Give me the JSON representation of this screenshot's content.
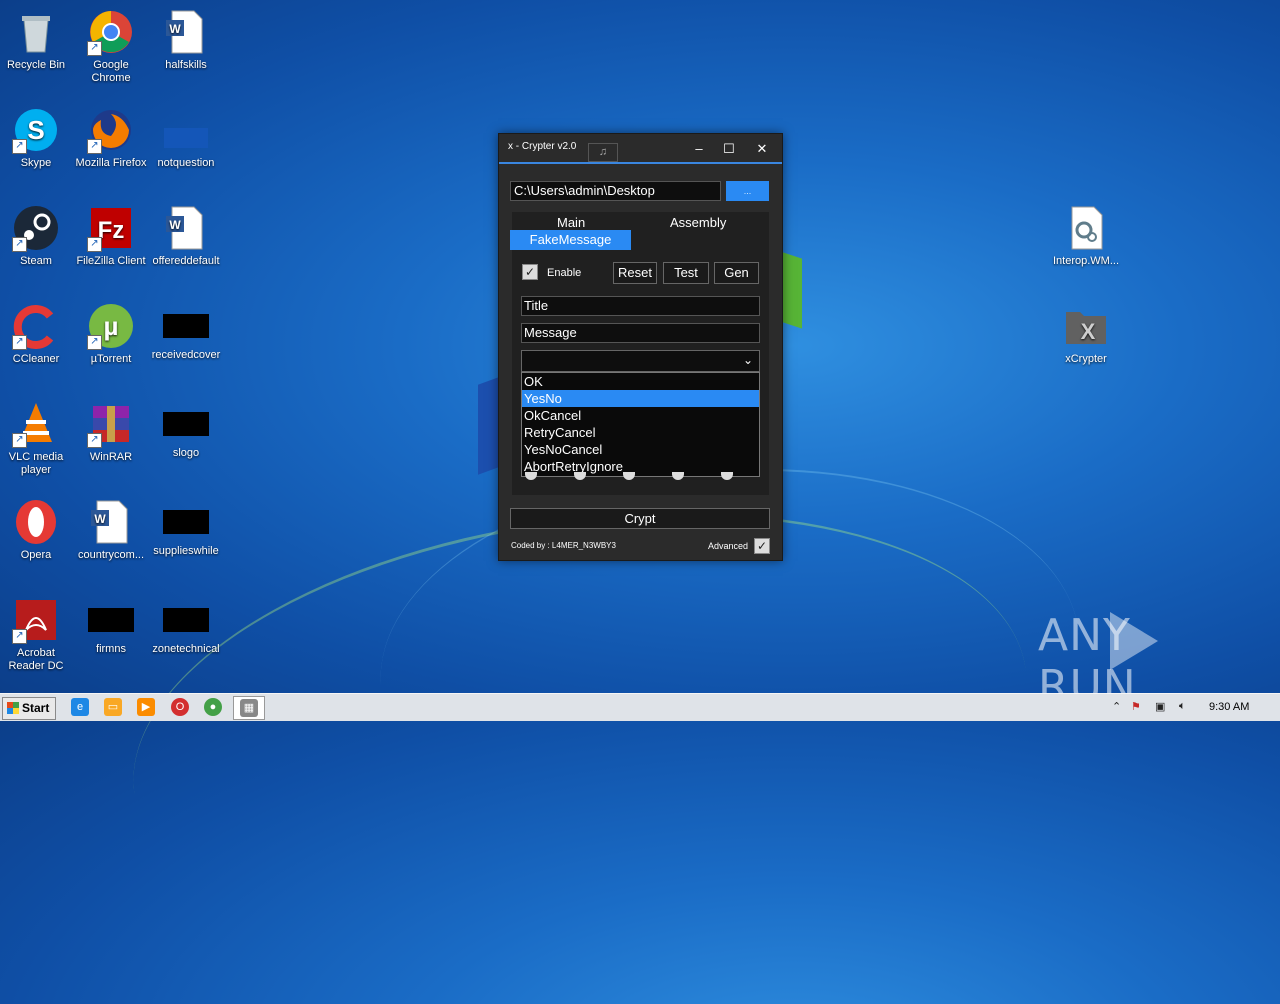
{
  "desktop": {
    "icons": [
      {
        "label": "Recycle Bin"
      },
      {
        "label": "Google Chrome"
      },
      {
        "label": "halfskills"
      },
      {
        "label": "Skype"
      },
      {
        "label": "Mozilla Firefox"
      },
      {
        "label": "notquestion"
      },
      {
        "label": "Steam"
      },
      {
        "label": "FileZilla Client"
      },
      {
        "label": "offereddefault"
      },
      {
        "label": "CCleaner"
      },
      {
        "label": "µTorrent"
      },
      {
        "label": "receivedcover"
      },
      {
        "label": "VLC media player"
      },
      {
        "label": "WinRAR"
      },
      {
        "label": "slogo"
      },
      {
        "label": "Opera"
      },
      {
        "label": "countrycom..."
      },
      {
        "label": "supplieswhile"
      },
      {
        "label": "Acrobat Reader DC"
      },
      {
        "label": "firmns"
      },
      {
        "label": "zonetechnical"
      },
      {
        "label": "Interop.WM..."
      },
      {
        "label": "xCrypter"
      }
    ]
  },
  "window": {
    "title": "x - Crypter v2.0",
    "music_icon": "♫",
    "minimize": "–",
    "maximize": "☐",
    "close": "✕",
    "path_value": "C:\\Users\\admin\\Desktop",
    "browse_label": "...",
    "tabs": {
      "main": "Main",
      "assembly": "Assembly",
      "fake_message": "FakeMessage"
    },
    "enable_label": "Enable",
    "enable_checked": true,
    "buttons": {
      "reset": "Reset",
      "test": "Test",
      "gen": "Gen"
    },
    "title_field": "Title",
    "message_field": "Message",
    "select_value": "",
    "dropdown_options": [
      "OK",
      "YesNo",
      "OkCancel",
      "RetryCancel",
      "YesNoCancel",
      "AbortRetryIgnore"
    ],
    "dropdown_selected": "YesNo",
    "crypt_label": "Crypt",
    "coded_by": "Coded by : L4MER_N3WBY3",
    "advanced_label": "Advanced",
    "advanced_checked": true
  },
  "taskbar": {
    "start_label": "Start",
    "clock": "9:30 AM"
  },
  "watermark": {
    "text_left": "ANY",
    "text_right": "RUN"
  }
}
